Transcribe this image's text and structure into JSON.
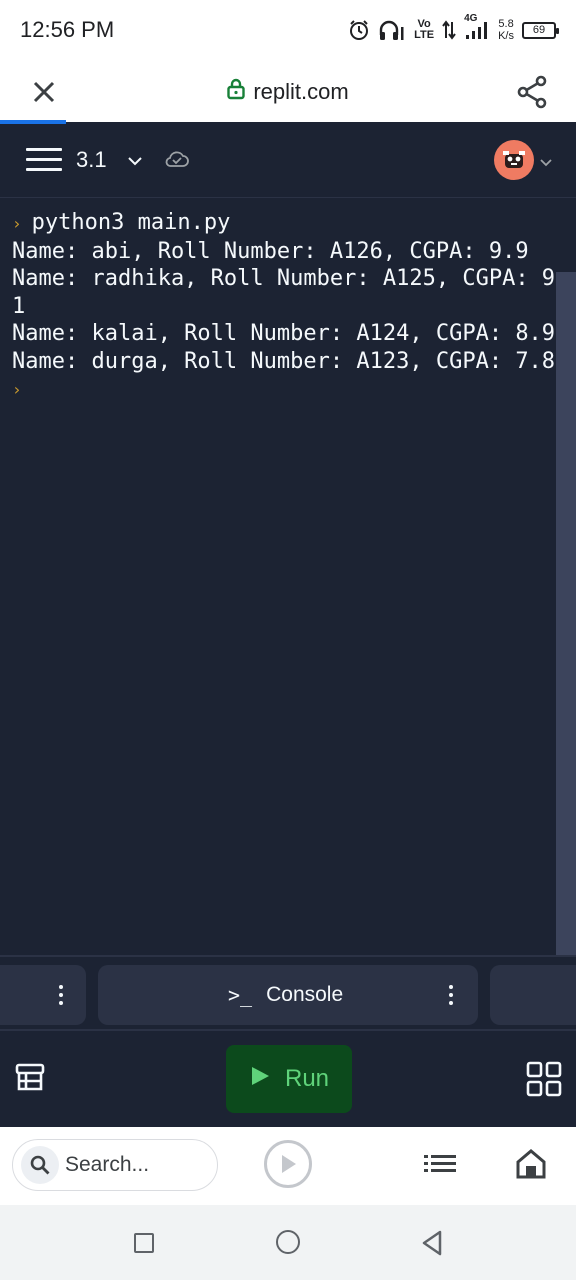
{
  "status_bar": {
    "time": "12:56 PM",
    "network_vo": "Vo",
    "network_lte": "LTE",
    "network_gen": "4G",
    "speed_value": "5.8",
    "speed_unit": "K/s",
    "battery": "69",
    "icons": [
      "alarm-icon",
      "headphones-icon",
      "data-arrows-icon",
      "signal-icon"
    ]
  },
  "browser": {
    "url": "replit.com",
    "close_icon": "close-icon",
    "share_icon": "share-icon",
    "lock_icon": "lock-icon"
  },
  "replit_header": {
    "repl_name": "3.1",
    "menu_icon": "hamburger-menu-icon",
    "cloud_icon": "cloud-check-icon"
  },
  "console": {
    "command": "python3 main.py",
    "lines": [
      "Name: abi, Roll Number: A126, CGPA: 9.9",
      "Name: radhika, Roll Number: A125, CGPA: 9.",
      "1",
      "Name: kalai, Roll Number: A124, CGPA: 8.9",
      "Name: durga, Roll Number: A123, CGPA: 7.8"
    ]
  },
  "tabs": {
    "console_label": "Console",
    "console_glyph": ">_"
  },
  "toolbar": {
    "run_label": "Run"
  },
  "browser_bottom": {
    "search_placeholder": "Search..."
  },
  "colors": {
    "background": "#1c2333",
    "panel": "#2b3245",
    "run_button": "#0c4a1c",
    "run_text": "#5fd37a",
    "prompt": "#c99a2e",
    "avatar": "#ef7b62",
    "progress": "#1a73e8"
  }
}
